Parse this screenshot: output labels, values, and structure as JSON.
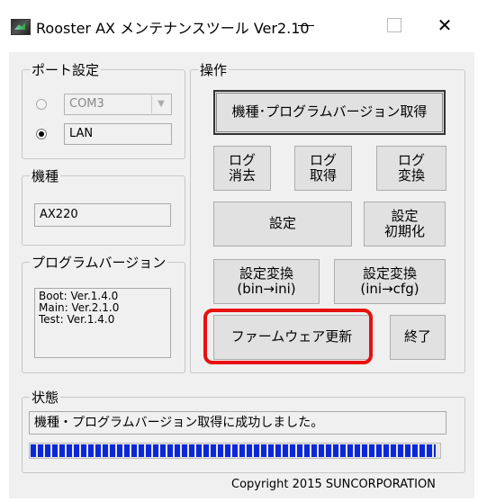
{
  "window": {
    "title": "Rooster AX メンテナンスツール Ver2.10"
  },
  "port": {
    "legend": "ポート設定",
    "com_value": "COM3",
    "lan_label": "LAN",
    "selected": "LAN"
  },
  "model": {
    "legend": "機種",
    "value": "AX220"
  },
  "version": {
    "legend": "プログラムバージョン",
    "lines": [
      "Boot: Ver.1.4.0",
      "Main: Ver.2.1.0",
      "Test: Ver.1.4.0"
    ]
  },
  "ops": {
    "legend": "操作",
    "get_version": "機種･プログラムバージョン取得",
    "log_clear": "ログ\n消去",
    "log_get": "ログ\n取得",
    "log_convert": "ログ\n変換",
    "settings": "設定",
    "settings_init": "設定\n初期化",
    "convert_bin_ini": "設定変換\n(bin→ini)",
    "convert_ini_cfg": "設定変換\n(ini→cfg)",
    "firmware_update": "ファームウェア更新",
    "exit": "終了"
  },
  "status": {
    "legend": "状態",
    "message": "機種・プログラムバージョン取得に成功しました。",
    "progress": 1.0
  },
  "footer": {
    "copyright": "Copyright 2015 SUNCORPORATION"
  },
  "colors": {
    "highlight": "#e81010",
    "progress": "#0a28d8"
  }
}
